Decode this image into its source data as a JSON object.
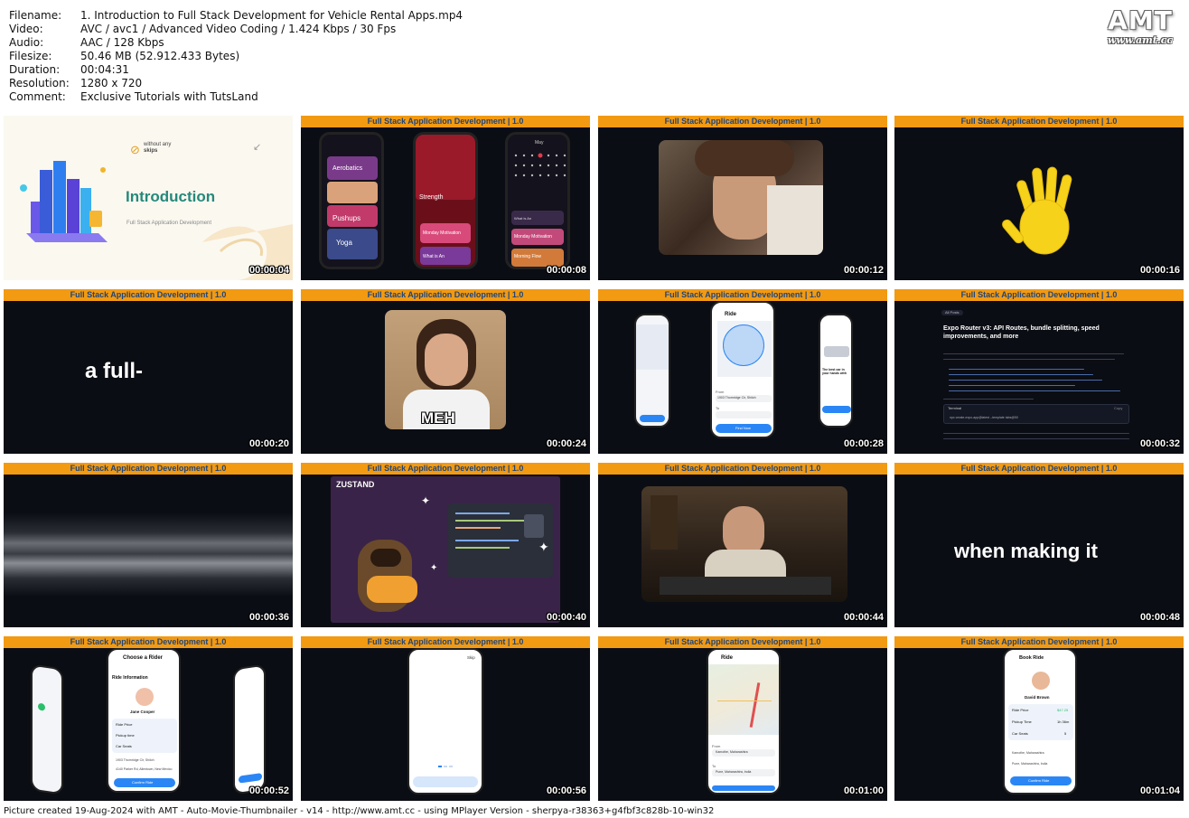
{
  "meta": {
    "rows": [
      {
        "key": "Filename:",
        "value": "1. Introduction to Full Stack Development for Vehicle Rental Apps.mp4"
      },
      {
        "key": "Video:",
        "value": "AVC / avc1 / Advanced Video Coding / 1.424 Kbps / 30 Fps"
      },
      {
        "key": "Audio:",
        "value": "AAC / 128 Kbps"
      },
      {
        "key": "Filesize:",
        "value": "50.46 MB (52.912.433 Bytes)"
      },
      {
        "key": "Duration:",
        "value": "00:04:31"
      },
      {
        "key": "Resolution:",
        "value": "1280 x 720"
      },
      {
        "key": "Comment:",
        "value": "Exclusive Tutorials with TutsLand"
      }
    ]
  },
  "logo": {
    "big": "AMT",
    "small": "www.amt.cc"
  },
  "banner_text": "Full Stack Application Development | 1.0",
  "thumbs": [
    {
      "time": "00:00:04",
      "intro_title": "Introduction",
      "intro_sub": "Full Stack Application Development",
      "badge_line1": "without any",
      "badge_line2": "skips"
    },
    {
      "time": "00:00:08",
      "labels": [
        "Aerobatics",
        "Pushups",
        "Yoga",
        "Strength",
        "Monday Motivation",
        "What is An",
        "May",
        "Monday Motivation",
        "Morning Flow",
        "What is An"
      ]
    },
    {
      "time": "00:00:12"
    },
    {
      "time": "00:00:16"
    },
    {
      "time": "00:00:20",
      "word": "a full-"
    },
    {
      "time": "00:00:24",
      "caption": "MEH"
    },
    {
      "time": "00:00:28",
      "labels": [
        "Ride",
        "From",
        "1903 Thornridge Cir, Shiloh",
        "To",
        "Find Now",
        "The best car in your hands with"
      ]
    },
    {
      "time": "00:00:32",
      "back": "All Posts",
      "title": "Expo Router v3: API Routes, bundle splitting, speed improvements, and more",
      "terminal": "Terminal",
      "copy": "Copy",
      "cmd": "npx create-expo-app@latest --template tabs@50"
    },
    {
      "time": "00:00:36"
    },
    {
      "time": "00:00:40",
      "logo": "ZUSTAND"
    },
    {
      "time": "00:00:44"
    },
    {
      "time": "00:00:48",
      "word": "when making it"
    },
    {
      "time": "00:00:52",
      "labels": [
        "Choose a Rider",
        "Ride Information",
        "Jane Cooper",
        "Ride Price",
        "Pickup time",
        "Car Seats",
        "1903 Thornridge Cir, Shiloh",
        "4140 Parker Rd, Allentown, New Mexico",
        "Confirm Ride"
      ]
    },
    {
      "time": "00:00:56",
      "skip": "Skip"
    },
    {
      "time": "00:01:00",
      "labels": [
        "Ride",
        "From",
        "Kamothe, Maharashtra",
        "To",
        "Pune, Maharashtra, India"
      ]
    },
    {
      "time": "00:01:04",
      "labels": [
        "Book Ride",
        "David Brown",
        "Ride Price",
        "$47.25",
        "Pickup Time",
        "1h 36m",
        "Car Seats",
        "5",
        "Kamothe, Maharashtra",
        "Pune, Maharashtra, India",
        "Confirm Ride"
      ]
    }
  ],
  "footer": "Picture created 19-Aug-2024 with AMT - Auto-Movie-Thumbnailer - v14 - http://www.amt.cc - using MPlayer Version - sherpya-r38363+g4fbf3c828b-10-win32"
}
